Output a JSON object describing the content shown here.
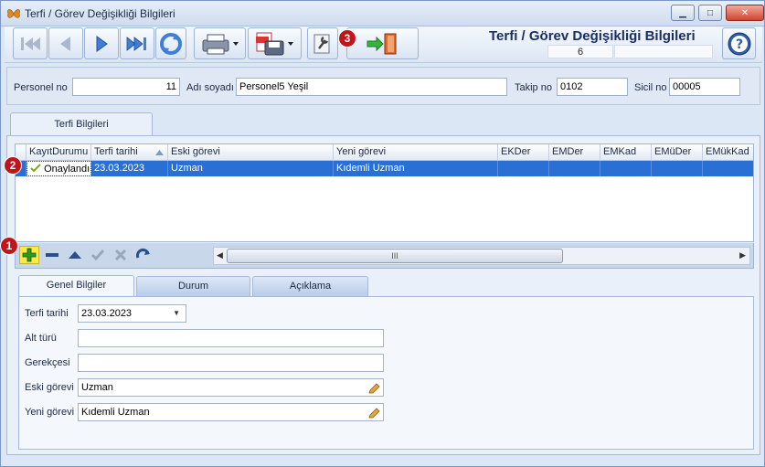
{
  "window": {
    "title": "Terfi / Görev Değişikliği Bilgileri",
    "controls": {
      "minimize": "▁",
      "maximize": "□",
      "close": "✕"
    }
  },
  "header": {
    "title": "Terfi / Görev Değişikliği Bilgileri",
    "count": "6"
  },
  "badges": {
    "add": "1",
    "row": "2",
    "exit": "3"
  },
  "person": {
    "personel_no_label": "Personel no",
    "personel_no": "11",
    "adi_soyadi_label": "Adı soyadı",
    "adi_soyadi": "Personel5 Yeşil",
    "takip_no_label": "Takip no",
    "takip_no": "0102",
    "sicil_no_label": "Sicil no",
    "sicil_no": "00005"
  },
  "main_tab": "Terfi Bilgileri",
  "grid": {
    "columns": [
      "KayıtDurumu",
      "Terfi tarihi",
      "Eski görevi",
      "Yeni görevi",
      "EKDer",
      "EMDer",
      "EMKad",
      "EMüDer",
      "EMükKad"
    ],
    "rows": [
      {
        "status": "Onaylandı",
        "terfi_tarihi": "23.03.2023",
        "eski_gorevi": "Uzman",
        "yeni_gorevi": "Kıdemli Uzman"
      }
    ],
    "scroll_grip": "III"
  },
  "subtabs": [
    "Genel Bilgiler",
    "Durum",
    "Açıklama"
  ],
  "form": {
    "terfi_tarihi_label": "Terfi tarihi",
    "terfi_tarihi": "23.03.2023",
    "alt_turu_label": "Alt türü",
    "alt_turu": "",
    "gerekcesi_label": "Gerekçesi",
    "gerekcesi": "",
    "eski_gorevi_label": "Eski görevi",
    "eski_gorevi": "Uzman",
    "yeni_gorevi_label": "Yeni görevi",
    "yeni_gorevi": "Kıdemli Uzman"
  },
  "colors": {
    "selection": "#2a6fd4",
    "badge": "#c2141a",
    "add_highlight": "#ffe949"
  }
}
